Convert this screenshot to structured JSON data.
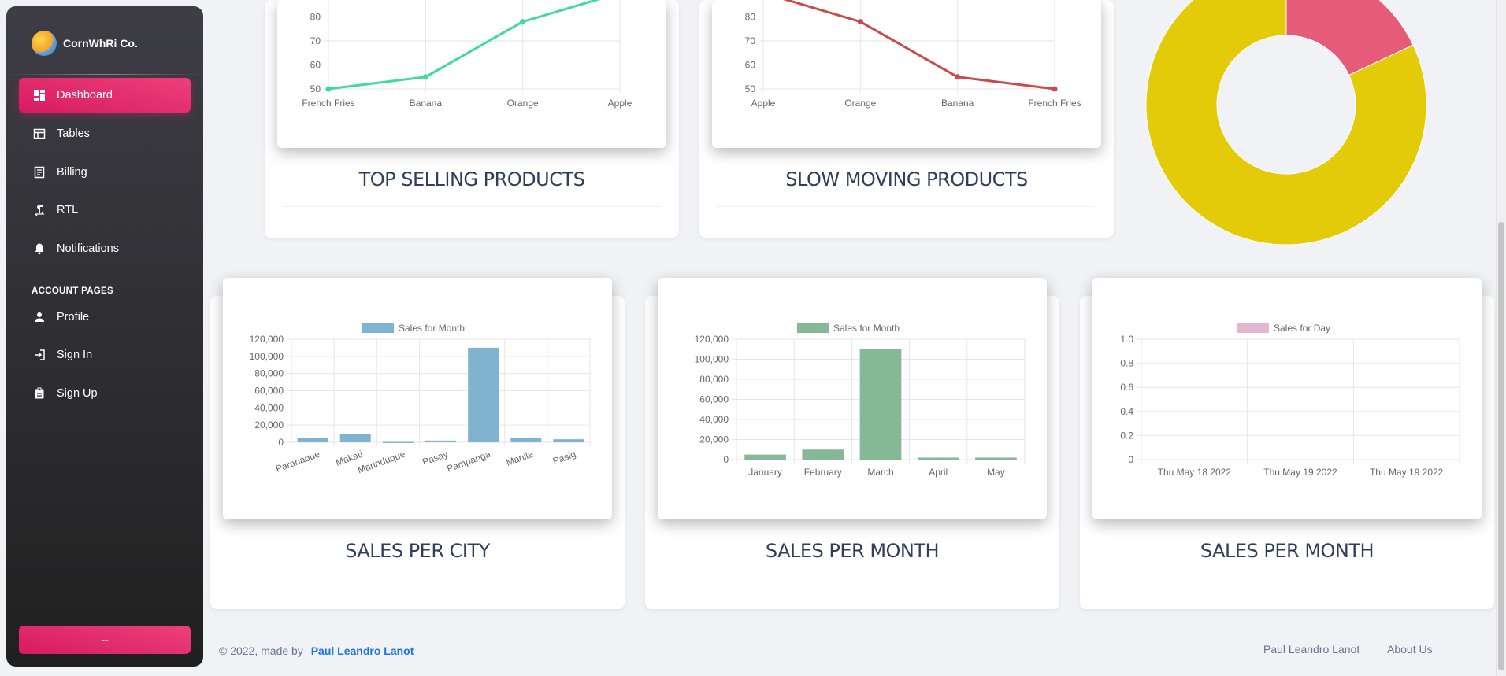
{
  "brand": {
    "name": "CornWhRi Co."
  },
  "sidebar": {
    "items": [
      {
        "label": "Dashboard",
        "icon": "dashboard-icon"
      },
      {
        "label": "Tables",
        "icon": "table-icon"
      },
      {
        "label": "Billing",
        "icon": "receipt-icon"
      },
      {
        "label": "RTL",
        "icon": "rtl-icon"
      },
      {
        "label": "Notifications",
        "icon": "bell-icon"
      }
    ],
    "section_label": "ACCOUNT PAGES",
    "account_items": [
      {
        "label": "Profile",
        "icon": "person-icon"
      },
      {
        "label": "Sign In",
        "icon": "login-icon"
      },
      {
        "label": "Sign Up",
        "icon": "assignment-icon"
      }
    ],
    "bottom_button": "--"
  },
  "cards": {
    "top_selling_title": "TOP SELLING PRODUCTS",
    "slow_moving_title": "SLOW MOVING PRODUCTS",
    "sales_city_title": "SALES PER CITY",
    "sales_month_title": "SALES PER MONTH",
    "sales_day_title": "SALES PER MONTH"
  },
  "colors": {
    "accent": "#e91e63",
    "line_green": "#3ddc97",
    "line_red": "#c94a4a",
    "bar_blue": "#7fb3cf",
    "bar_green": "#84b896",
    "legend_pink": "#e3b8cf",
    "donut_yellow": "#e3cb0a",
    "donut_pink": "#e65a7a"
  },
  "chart_data": [
    {
      "id": "top-selling",
      "type": "line",
      "categories": [
        "French Fries",
        "Banana",
        "Orange",
        "Apple"
      ],
      "values": [
        50,
        55,
        78,
        90
      ],
      "yticks": [
        50,
        60,
        70,
        80
      ],
      "ylim": [
        50,
        90
      ]
    },
    {
      "id": "slow-moving",
      "type": "line",
      "categories": [
        "Apple",
        "Orange",
        "Banana",
        "French Fries"
      ],
      "values": [
        90,
        78,
        55,
        50
      ],
      "yticks": [
        50,
        60,
        70,
        80
      ],
      "ylim": [
        50,
        90
      ]
    },
    {
      "id": "donut",
      "type": "pie",
      "values": [
        18,
        82
      ]
    },
    {
      "id": "sales-city",
      "type": "bar",
      "legend": "Sales for Month",
      "categories": [
        "Paranaque",
        "Makati",
        "Marinduque",
        "Pasay",
        "Pampanga",
        "Manila",
        "Pasig"
      ],
      "values": [
        5000,
        10000,
        500,
        2000,
        110000,
        5000,
        3500
      ],
      "yticks": [
        "0",
        "20,000",
        "40,000",
        "60,000",
        "80,000",
        "100,000",
        "120,000"
      ],
      "ylim": [
        0,
        120000
      ]
    },
    {
      "id": "sales-month",
      "type": "bar",
      "legend": "Sales for Month",
      "categories": [
        "January",
        "February",
        "March",
        "April",
        "May"
      ],
      "values": [
        5000,
        10000,
        110000,
        2000,
        2000
      ],
      "yticks": [
        "0",
        "20,000",
        "40,000",
        "60,000",
        "80,000",
        "100,000",
        "120,000"
      ],
      "ylim": [
        0,
        120000
      ]
    },
    {
      "id": "sales-day",
      "type": "bar",
      "legend": "Sales for Day",
      "categories": [
        "Thu May 18 2022",
        "Thu May 19 2022",
        "Thu May 19 2022"
      ],
      "values": [
        0,
        0,
        0
      ],
      "yticks": [
        "0",
        "0.2",
        "0.4",
        "0.6",
        "0.8",
        "1.0"
      ],
      "ylim": [
        0,
        1
      ]
    }
  ],
  "footer": {
    "copyright": "© 2022, made by",
    "author_link": "Paul Leandro Lanot",
    "links": [
      "Paul Leandro Lanot",
      "About Us"
    ]
  }
}
